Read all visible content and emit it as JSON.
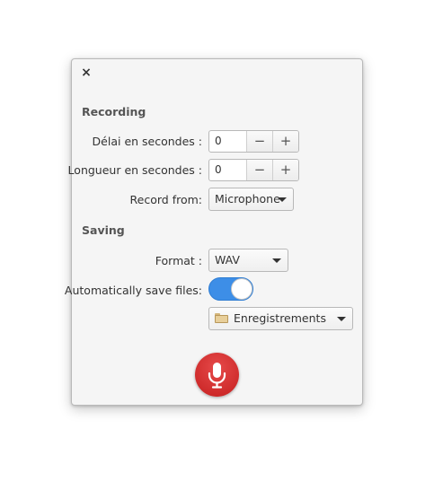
{
  "window": {
    "close_label": "×"
  },
  "recording": {
    "title": "Recording",
    "delay": {
      "label": "Délai en secondes :",
      "value": "0",
      "minus": "−",
      "plus": "+"
    },
    "length": {
      "label": "Longueur en secondes :",
      "value": "0",
      "minus": "−",
      "plus": "+"
    },
    "source": {
      "label": "Record from:",
      "value": "Microphone"
    }
  },
  "saving": {
    "title": "Saving",
    "format": {
      "label": "Format :",
      "value": "WAV"
    },
    "autosave": {
      "label": "Automatically save files:",
      "enabled": true
    },
    "folder": {
      "value": "Enregistrements",
      "icon": "folder-icon"
    }
  },
  "record_button": {
    "icon": "microphone-icon",
    "color": "#d62c2c"
  }
}
